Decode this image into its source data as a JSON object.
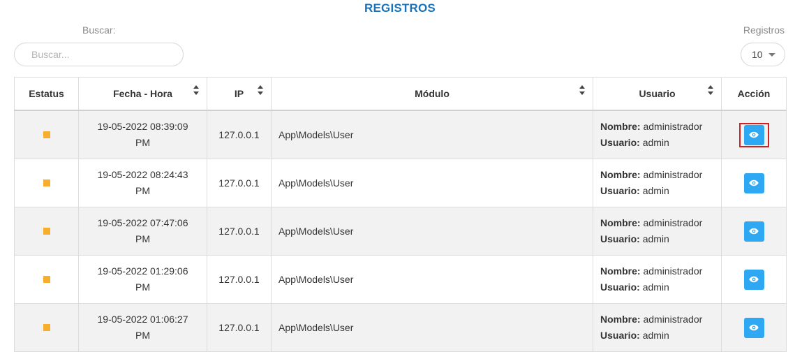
{
  "page": {
    "title": "REGISTROS"
  },
  "search": {
    "label": "Buscar:",
    "placeholder": "Buscar..."
  },
  "records": {
    "label": "Registros",
    "value": "10"
  },
  "table": {
    "headers": {
      "status": "Estatus",
      "datetime": "Fecha - Hora",
      "ip": "IP",
      "module": "Módulo",
      "user": "Usuario",
      "action": "Acción"
    },
    "user_name_key": "Nombre:",
    "user_login_key": "Usuario:",
    "rows": [
      {
        "date": "19-05-2022 08:39:09",
        "ampm": "PM",
        "ip": "127.0.0.1",
        "module": "App\\Models\\User",
        "name": "administrador",
        "login": "admin",
        "highlighted": true
      },
      {
        "date": "19-05-2022 08:24:43",
        "ampm": "PM",
        "ip": "127.0.0.1",
        "module": "App\\Models\\User",
        "name": "administrador",
        "login": "admin"
      },
      {
        "date": "19-05-2022 07:47:06",
        "ampm": "PM",
        "ip": "127.0.0.1",
        "module": "App\\Models\\User",
        "name": "administrador",
        "login": "admin"
      },
      {
        "date": "19-05-2022 01:29:06",
        "ampm": "PM",
        "ip": "127.0.0.1",
        "module": "App\\Models\\User",
        "name": "administrador",
        "login": "admin"
      },
      {
        "date": "19-05-2022 01:06:27",
        "ampm": "PM",
        "ip": "127.0.0.1",
        "module": "App\\Models\\User",
        "name": "administrador",
        "login": "admin"
      }
    ]
  },
  "colors": {
    "title": "#1a73b8",
    "status_square": "#f9ad2d",
    "view_button": "#2ea8f2",
    "highlight_border": "#d81f1f"
  },
  "icons": {
    "view": "eye-icon",
    "sort": "sort-icon",
    "dropdown": "caret-down-icon"
  }
}
